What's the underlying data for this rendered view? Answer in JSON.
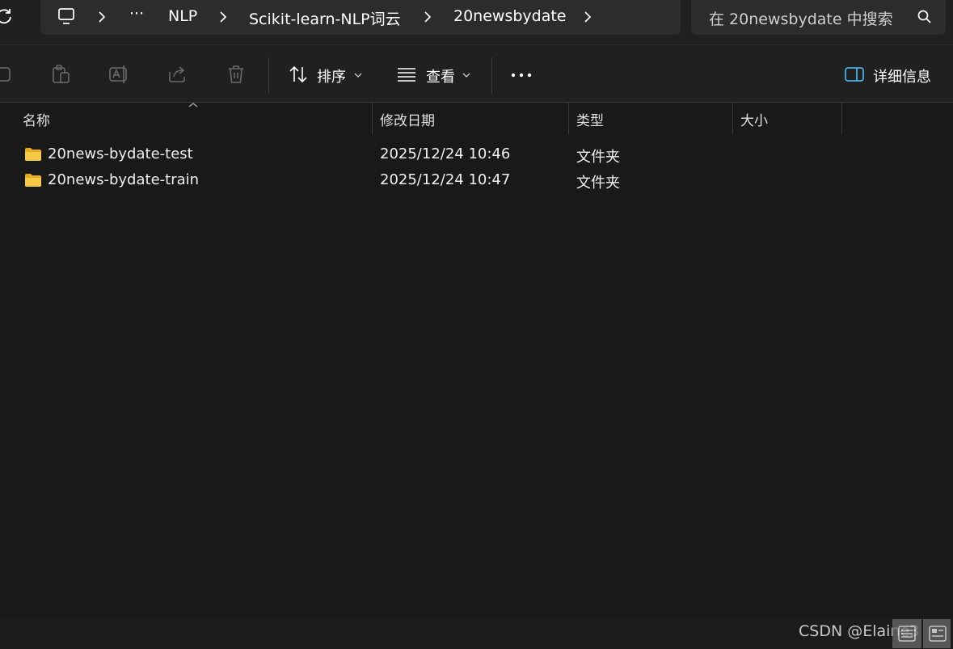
{
  "breadcrumb": {
    "overflow": "···",
    "items": [
      "NLP",
      "Scikit-learn-NLP词云",
      "20newsbydate"
    ]
  },
  "search": {
    "placeholder": "在 20newsbydate 中搜索"
  },
  "toolbar": {
    "sort_label": "排序",
    "view_label": "查看",
    "details_label": "详细信息"
  },
  "columns": {
    "name": "名称",
    "modified": "修改日期",
    "type": "类型",
    "size": "大小"
  },
  "files": [
    {
      "name": "20news-bydate-test",
      "modified": "2025/12/24 10:46",
      "type": "文件夹",
      "size": ""
    },
    {
      "name": "20news-bydate-train",
      "modified": "2025/12/24 10:47",
      "type": "文件夹",
      "size": ""
    }
  ],
  "watermark": "CSDN @Elaine3",
  "colors": {
    "folder": "#f7c948",
    "background": "#191919",
    "toolbar": "#202020",
    "accent": "#4cc2ff"
  },
  "icons": [
    "refresh-icon",
    "computer-icon",
    "search-icon",
    "paste-icon",
    "rename-icon",
    "share-icon",
    "delete-icon",
    "sort-icon",
    "view-icon",
    "more-icon",
    "details-pane-icon",
    "folder-icon"
  ]
}
